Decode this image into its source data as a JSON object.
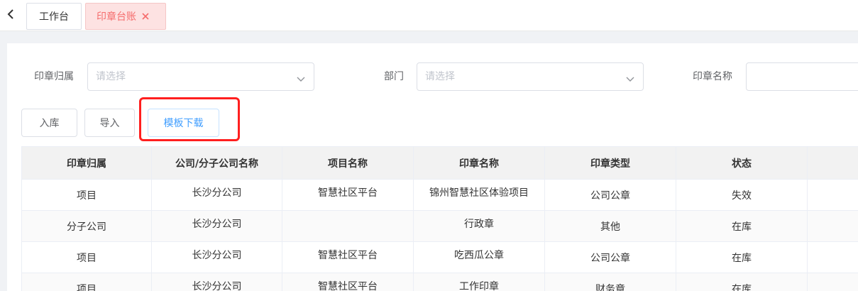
{
  "tabs": {
    "home_label": "工作台",
    "active_label": "印章台账"
  },
  "filters": {
    "owner_label": "印章归属",
    "owner_placeholder": "请选择",
    "dept_label": "部门",
    "dept_placeholder": "请选择",
    "seal_name_label": "印章名称"
  },
  "toolbar": {
    "stock_in": "入库",
    "import": "导入",
    "template_download": "模板下载"
  },
  "table": {
    "headers": [
      "印章归属",
      "公司/分子公司名称",
      "项目名称",
      "印章名称",
      "印章类型",
      "状态",
      ""
    ],
    "rows": [
      [
        "项目",
        "长沙分公司",
        "智慧社区平台",
        "锦州智慧社区体验项目",
        "公司公章",
        "失效"
      ],
      [
        "分子公司",
        "长沙分公司",
        "",
        "行政章",
        "其他",
        "在库"
      ],
      [
        "项目",
        "长沙分公司",
        "智慧社区平台",
        "吃西瓜公章",
        "公司公章",
        "在库"
      ],
      [
        "项目",
        "长沙分公司",
        "智慧社区平台",
        "工作印章",
        "财务章",
        "在库"
      ]
    ]
  },
  "colors": {
    "accent": "#409eff",
    "active_tab_bg": "#fde2e2",
    "active_tab_text": "#f56c6c",
    "highlight": "#ff1f1f"
  }
}
